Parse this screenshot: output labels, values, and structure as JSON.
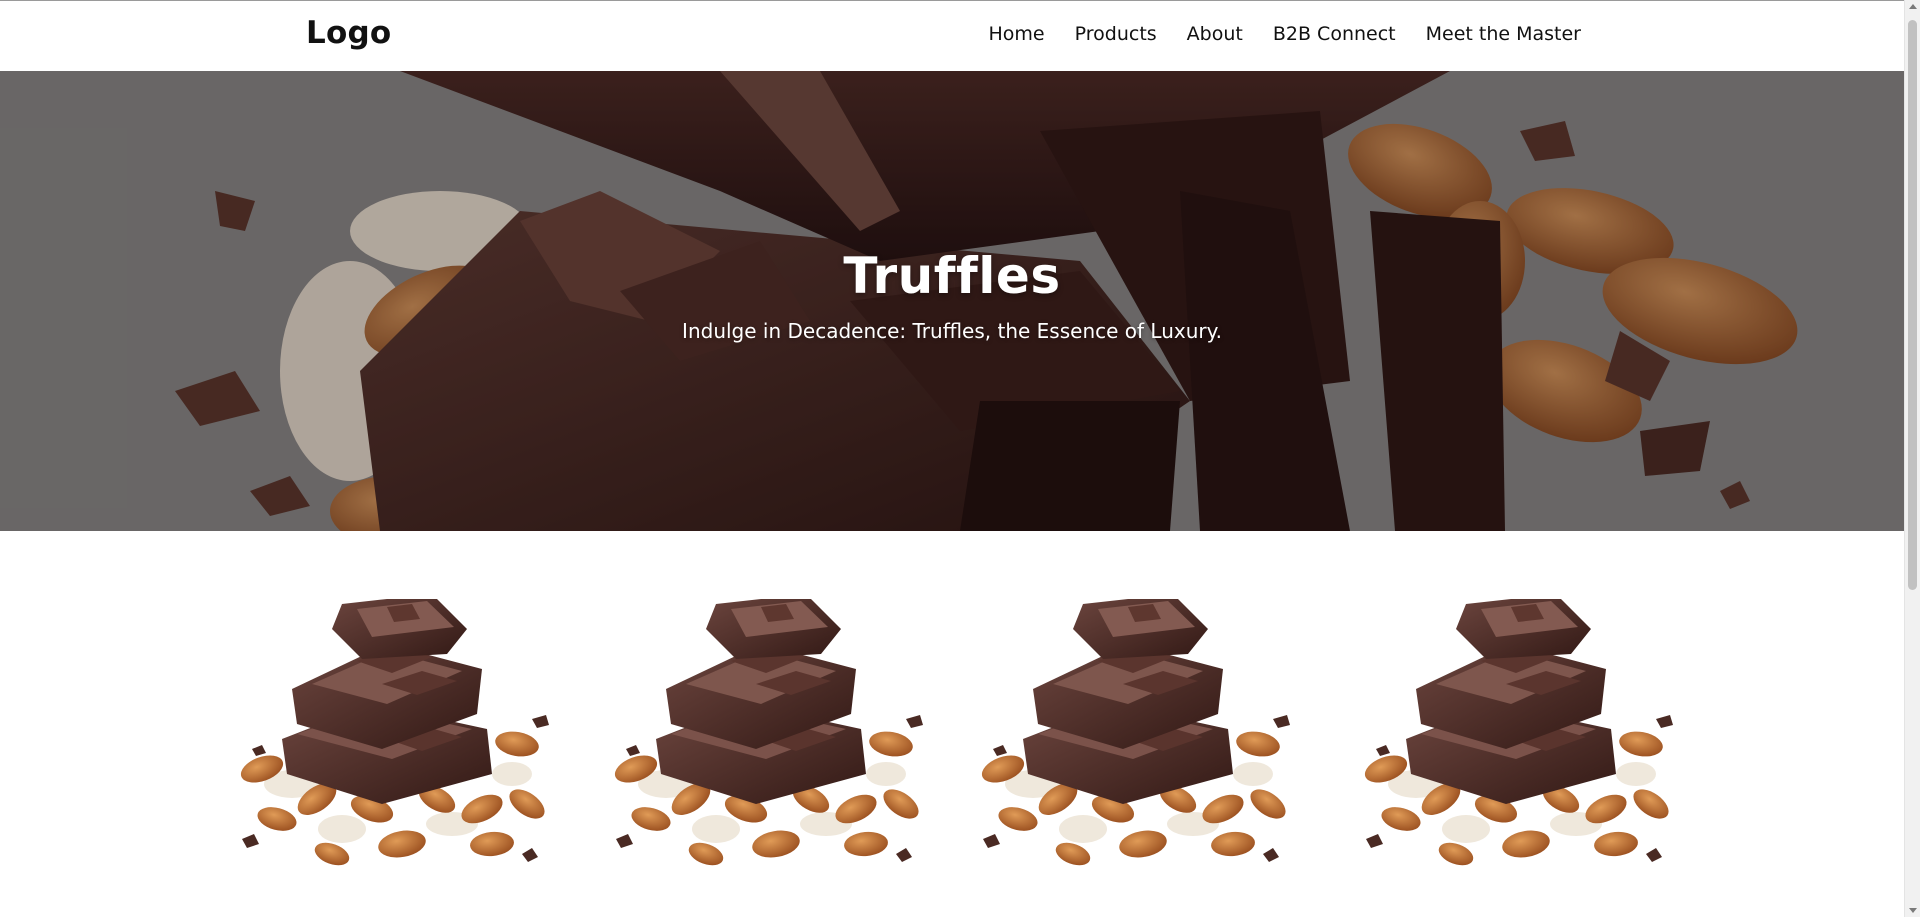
{
  "header": {
    "logo": "Logo",
    "nav": [
      "Home",
      "Products",
      "About",
      "B2B Connect",
      "Meet the Master"
    ]
  },
  "hero": {
    "title": "Truffles",
    "subtitle": "Indulge in Decadence: Truffles, the Essence of Luxury."
  },
  "products": {
    "count_visible": 4,
    "image": "chocolate-almond-image"
  },
  "colors": {
    "chocolate_dark": "#3b1f19",
    "chocolate_mid": "#5a3329",
    "almond": "#b8743f",
    "white_chocolate": "#efe8dc",
    "text_dark": "#111111"
  }
}
